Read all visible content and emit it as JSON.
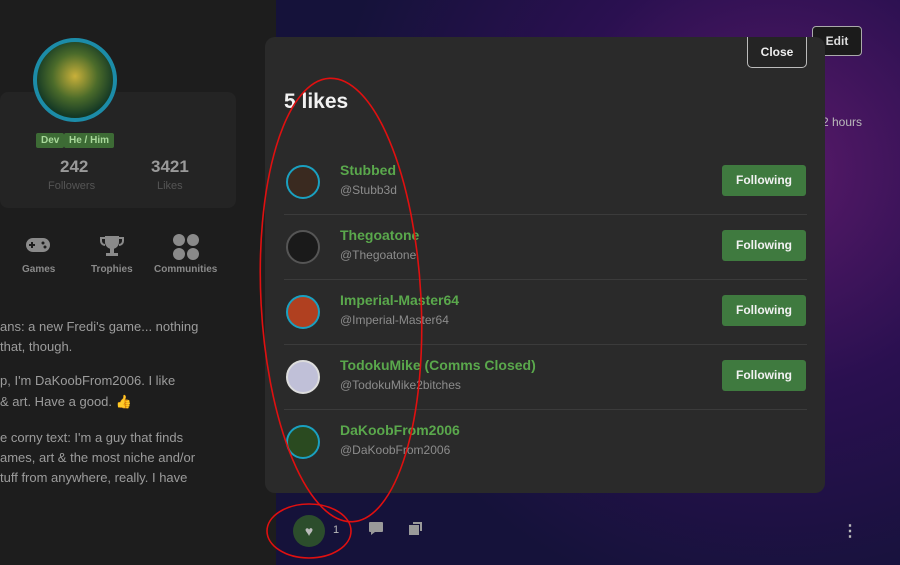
{
  "profile": {
    "badges": [
      "Dev",
      "He / Him"
    ],
    "stats": [
      {
        "value": "242",
        "label": "Followers"
      },
      {
        "value": "3421",
        "label": "Likes"
      }
    ],
    "nav": [
      {
        "icon": "gamepad-icon",
        "label": "Games"
      },
      {
        "icon": "trophy-icon",
        "label": "Trophies"
      },
      {
        "icon": "communities-icon",
        "label": "Communities"
      }
    ],
    "bio_lines": [
      "ans: a new Fredi's game... nothing",
      "that, though.",
      "p, I'm DaKoobFrom2006. I like",
      "& art. Have a good. 👍",
      "e corny text: I'm a guy that finds",
      "ames, art & the most niche and/or",
      "tuff from anywhere, really. I have"
    ]
  },
  "post": {
    "edit_label": "Edit",
    "time": "2 hours",
    "like_count": "1"
  },
  "modal": {
    "close_label": "Close",
    "title": "5 likes",
    "users": [
      {
        "name": "Stubbed",
        "handle": "@Stubb3d",
        "button": "Following",
        "avatar_color": "#3a2a20"
      },
      {
        "name": "Thegoatone",
        "handle": "@Thegoatone",
        "button": "Following",
        "avatar_color": "#1a1a1a"
      },
      {
        "name": "Imperial-Master64",
        "handle": "@Imperial-Master64",
        "button": "Following",
        "avatar_color": "#b04020"
      },
      {
        "name": "TodokuMike (Comms Closed)",
        "handle": "@TodokuMike2bitches",
        "button": "Following",
        "avatar_color": "#c0c0d8"
      },
      {
        "name": "DaKoobFrom2006",
        "handle": "@DaKoobFrom2006",
        "button": "",
        "avatar_color": "#2a4a20"
      }
    ]
  },
  "colors": {
    "accent_green": "#3f7a3f",
    "name_green": "#5aa84c",
    "annotation_red": "#e01010"
  }
}
